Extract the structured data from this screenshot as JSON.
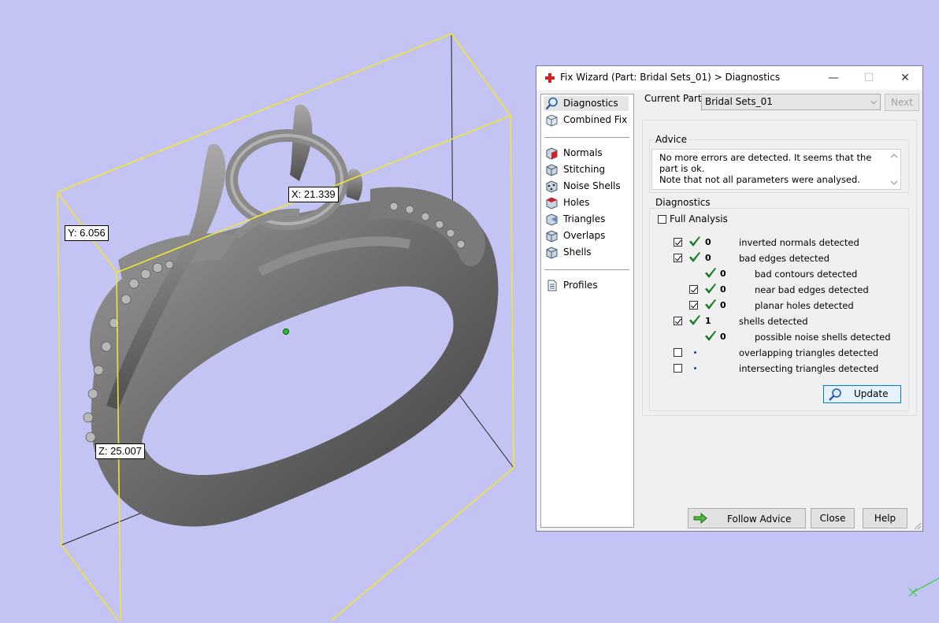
{
  "viewport": {
    "dimensions": {
      "x": "X: 21.339",
      "y": "Y: 6.056",
      "z": "Z: 25.007"
    }
  },
  "fix_wizard": {
    "title": "Fix Wizard (Part: Bridal Sets_01) > Diagnostics",
    "title_icon": "red-cross-icon",
    "window_controls": {
      "minimize": "—",
      "maximize": "☐",
      "close": "✕"
    },
    "nav": {
      "selected": "Diagnostics",
      "groups": [
        [
          {
            "label": "Diagnostics",
            "icon": "magnifier-icon"
          },
          {
            "label": "Combined Fix",
            "icon": "cube-icon"
          }
        ],
        [
          {
            "label": "Normals",
            "icon": "normals-cube-icon"
          },
          {
            "label": "Stitching",
            "icon": "stitching-cube-icon"
          },
          {
            "label": "Noise Shells",
            "icon": "noise-shells-icon"
          },
          {
            "label": "Holes",
            "icon": "holes-cube-icon"
          },
          {
            "label": "Triangles",
            "icon": "triangles-cube-icon"
          },
          {
            "label": "Overlaps",
            "icon": "overlaps-cube-icon"
          },
          {
            "label": "Shells",
            "icon": "shells-cube-icon"
          }
        ],
        [
          {
            "label": "Profiles",
            "icon": "document-icon"
          }
        ]
      ]
    },
    "current_part": {
      "label": "Current Part:",
      "value": "Bridal Sets_01",
      "next_label": "Next"
    },
    "advice": {
      "title": "Advice",
      "line1": "No more errors are detected. It seems that the part is ok.",
      "line2": "Note that not all parameters were analysed."
    },
    "diagnostics": {
      "title": "Diagnostics",
      "full_analysis_label": "Full Analysis",
      "full_analysis_checked": false,
      "rows": [
        {
          "label": "inverted normals detected",
          "count": "0",
          "checkbox": true,
          "checked": true,
          "status": "ok",
          "indent": 0
        },
        {
          "label": "bad edges detected",
          "count": "0",
          "checkbox": true,
          "checked": true,
          "status": "ok",
          "indent": 0
        },
        {
          "label": "bad contours detected",
          "count": "0",
          "checkbox": false,
          "checked": false,
          "status": "ok",
          "indent": 1
        },
        {
          "label": "near bad edges detected",
          "count": "0",
          "checkbox": true,
          "checked": true,
          "status": "ok",
          "indent": 1
        },
        {
          "label": "planar holes detected",
          "count": "0",
          "checkbox": true,
          "checked": true,
          "status": "ok",
          "indent": 1
        },
        {
          "label": "shells detected",
          "count": "1",
          "checkbox": true,
          "checked": true,
          "status": "ok",
          "indent": 0
        },
        {
          "label": "possible noise shells detected",
          "count": "0",
          "checkbox": false,
          "checked": false,
          "status": "ok",
          "indent": 1
        },
        {
          "label": "overlapping triangles detected",
          "count": "",
          "checkbox": true,
          "checked": false,
          "status": "pending",
          "indent": 0
        },
        {
          "label": "intersecting triangles detected",
          "count": "",
          "checkbox": true,
          "checked": false,
          "status": "pending",
          "indent": 0
        }
      ],
      "update_label": "Update"
    },
    "footer": {
      "follow_advice_label": "Follow Advice",
      "close_label": "Close",
      "help_label": "Help"
    },
    "colors": {
      "check_green": "#1a7a2a",
      "bounding_box_yellow": "#f0e630",
      "background": "#c4c4f4"
    }
  }
}
